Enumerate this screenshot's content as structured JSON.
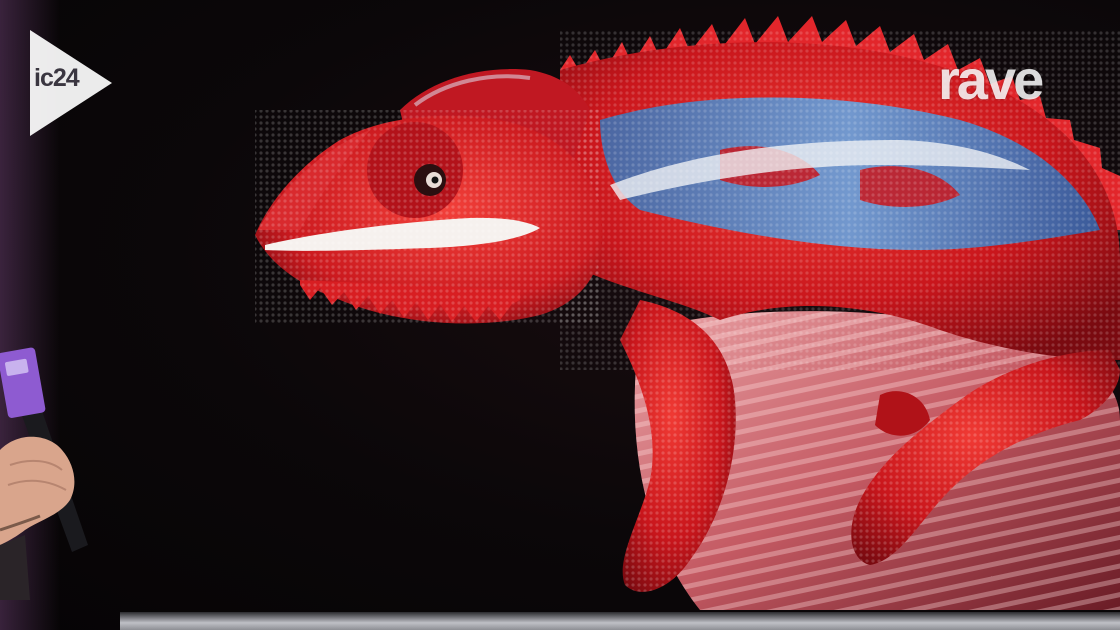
{
  "overlay": {
    "ic24_logo_text": "ic24",
    "rave_logo_text": "rave"
  },
  "colors": {
    "chameleon_red": "#d81e22",
    "chameleon_blue": "#4f8fd2",
    "stripe_white": "#f2e6e6",
    "rock_pink": "#d8828a",
    "logo_white": "#ffffff",
    "mic_purple": "#8e5bd1"
  },
  "icons": {
    "ic24": "play-triangle-logo",
    "rave": "rave-wordmark"
  }
}
